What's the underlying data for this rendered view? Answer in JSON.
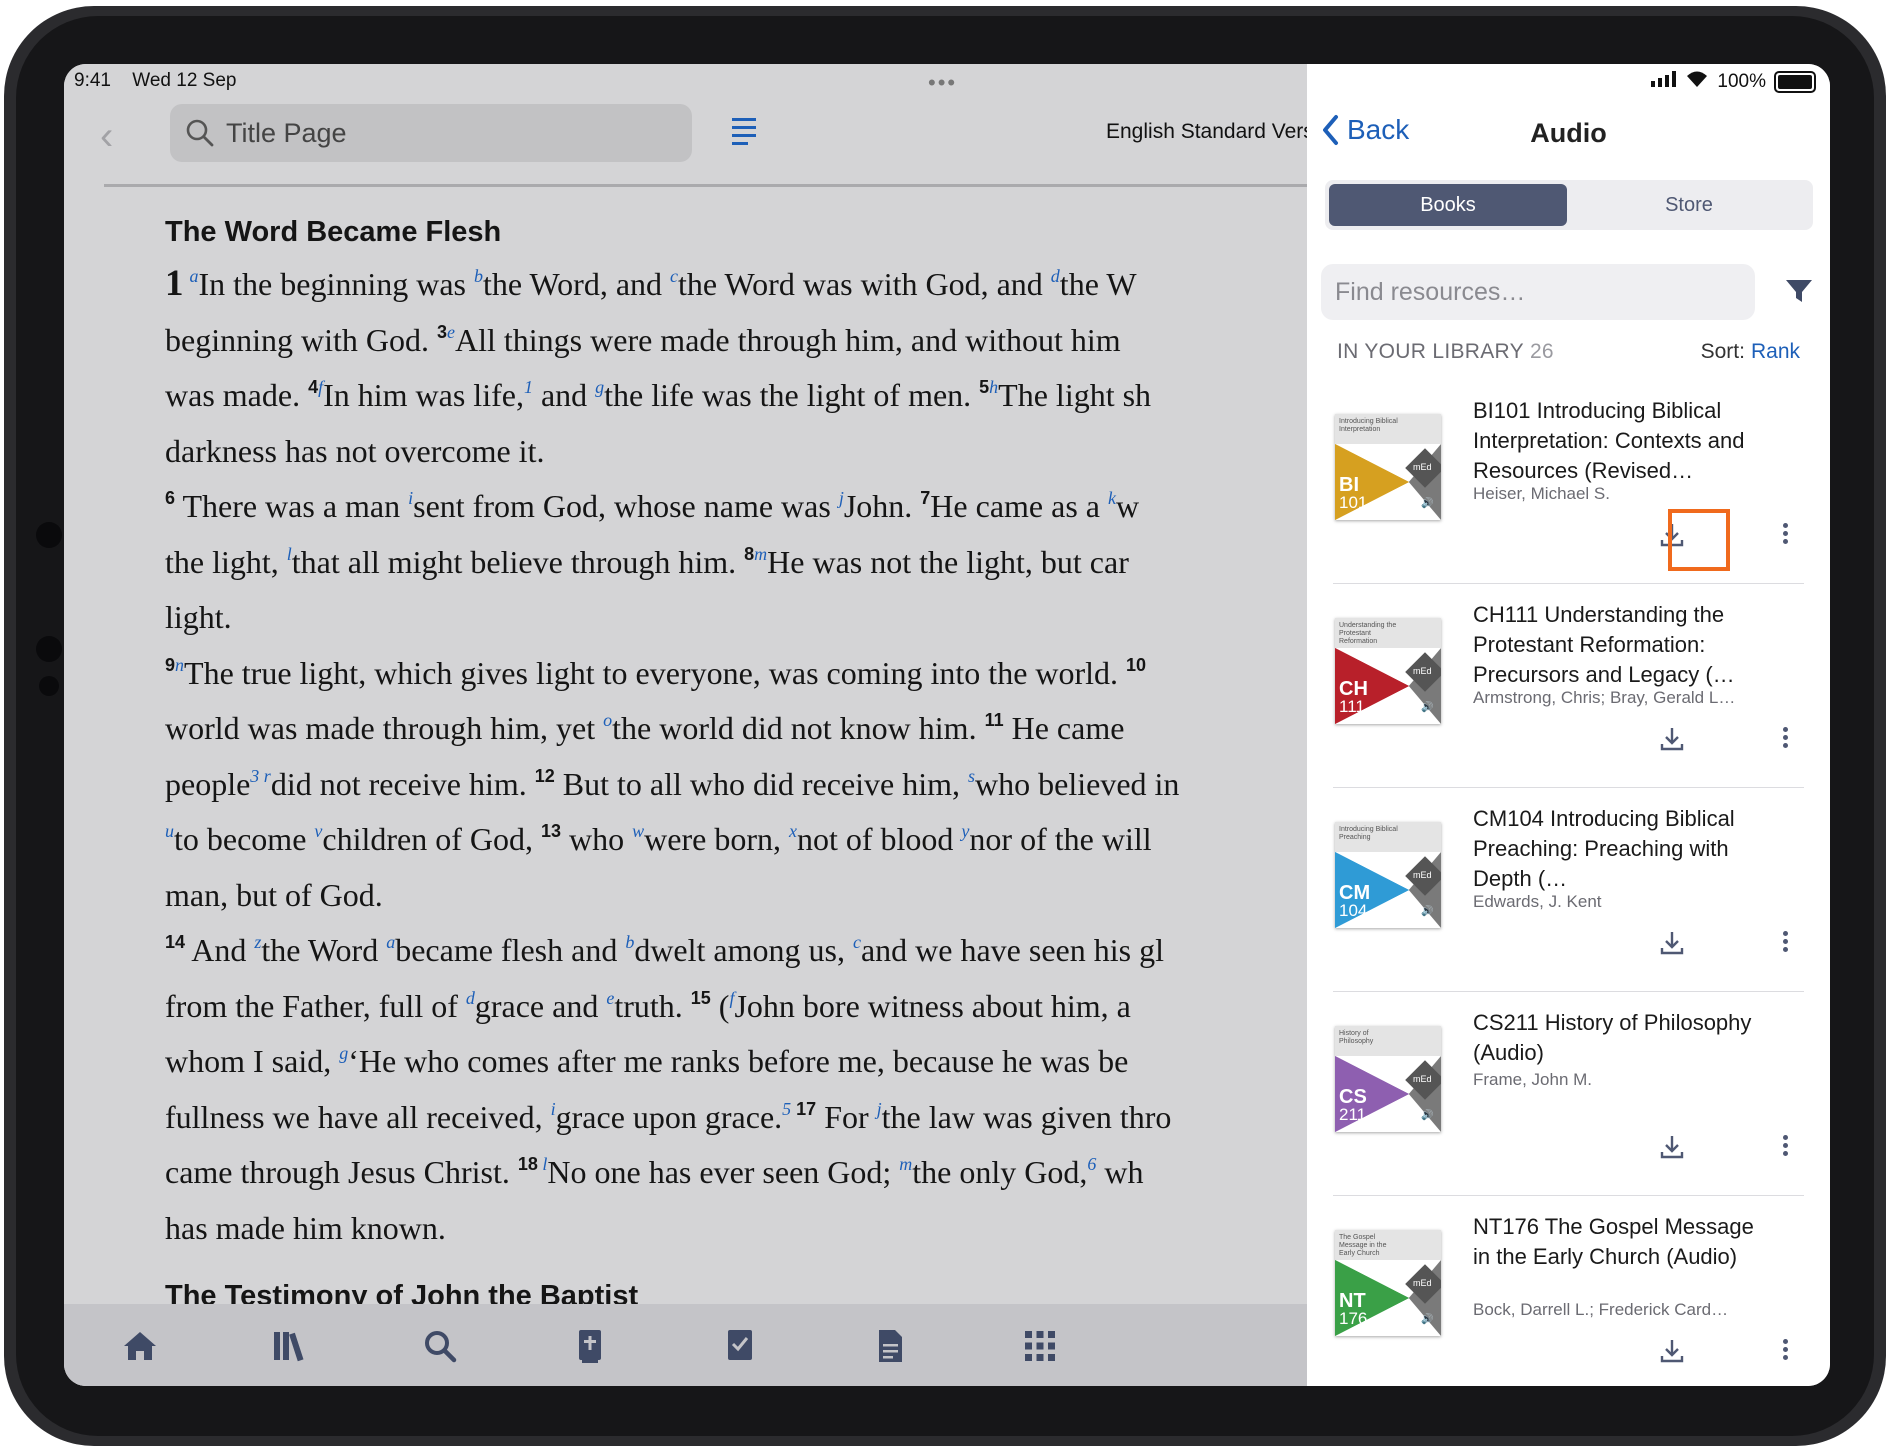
{
  "status": {
    "time": "9:41",
    "date": "Wed 12 Sep",
    "battery": "100%"
  },
  "reader": {
    "search_label": "Title Page",
    "version_label": "English Standard Vers",
    "heading": "The Word Became Flesh",
    "next_heading": "The Testimony of John the Baptist",
    "lines": [
      "In the beginning was the Word, and the Word was with God, and the W",
      "beginning with God. All things were made through him, and without him",
      "was made. In him was life, and the life was the light of men. The light sh",
      "darkness has not overcome it.",
      "There was a man sent from God, whose name was John. He came as a w",
      "the light, that all might believe through him. He was not the light, but car",
      "light.",
      "The true light, which gives light to everyone, was coming into the world.",
      "world was made through him, yet the world did not know him. He came",
      "people did not receive him. But to all who did receive him, who believed in",
      "to become children of God, who were born, not of blood nor of the will",
      "man, but of God.",
      "And the Word became flesh and dwelt among us, and we have seen his gl",
      "from the Father, full of grace and truth. (John bore witness about him, a",
      "whom I said, ‘He who comes after me ranks before me, because he was be",
      "fullness we have all received, grace upon grace. For the law was given thro",
      "came through Jesus Christ. No one has ever seen God; the only God, wh",
      "has made him known."
    ],
    "seg": {
      "l1a": "In the beginning was ",
      "l1b": "the Word, and ",
      "l1c": "the Word was with God, and ",
      "l1d": "the W",
      "l2a": "beginning with God. ",
      "l2b": "All things were made through him, and without him",
      "l3a": "was made. ",
      "l3b": "In him was life,",
      "l3c": " and ",
      "l3d": "the life was the light of men. ",
      "l3e": "The light sh",
      "l5a": " There was a man ",
      "l5b": "sent from God, whose name was ",
      "l5c": "John. ",
      "l5d": "He came as a ",
      "l5e": "w",
      "l6a": "the light, ",
      "l6b": "that all might believe through him. ",
      "l6c": "He was not the light, but car",
      "l8a": "The true light, which gives light to everyone, was coming into the world. ",
      "l9a": "world was made through him, yet ",
      "l9b": "the world did not know him. ",
      "l9c": " He came",
      "l10a": "people",
      "l10b": "did not receive him. ",
      "l10c": " But to all who did receive him, ",
      "l10d": "who believed in",
      "l11a": "to become ",
      "l11b": "children of God, ",
      "l11c": " who ",
      "l11d": "were born, ",
      "l11e": "not of blood ",
      "l11f": "nor of the will",
      "l13a": " And ",
      "l13b": "the Word ",
      "l13c": "became flesh and ",
      "l13d": "dwelt among us, ",
      "l13e": "and we have seen his gl",
      "l14a": "from the Father, full of ",
      "l14b": "grace and ",
      "l14c": "truth. ",
      "l14d": " (",
      "l14e": "John bore witness about him, a",
      "l15a": "whom I said, ",
      "l15b": "‘He who comes after me ranks before me, because he was be",
      "l16a": "fullness we have all received, ",
      "l16b": "grace upon grace.",
      "l16c": " For ",
      "l16d": "the law was given thro",
      "l17a": "came through Jesus Christ. ",
      "l17b": "No one has ever seen God; ",
      "l17c": "the only God,",
      "l17d": " wh"
    },
    "tabs": [
      "home",
      "library",
      "search",
      "bible",
      "plans",
      "notes",
      "more"
    ]
  },
  "panel": {
    "back_label": "Back",
    "title": "Audio",
    "segment_books": "Books",
    "segment_store": "Store",
    "search_placeholder": "Find resources…",
    "library_label": "IN YOUR LIBRARY",
    "library_count": "26",
    "sort_label": "Sort:",
    "sort_value": "Rank",
    "items": [
      {
        "title": "BI101 Introducing Biblical Interpretation: Contexts and Resources (Revised…",
        "author": "Heiser, Michael S.",
        "code": "BI",
        "num": "101",
        "band": "Introducing Biblical Interpretation",
        "color": "#d6a020"
      },
      {
        "title": "CH111 Understanding the Protestant Reformation: Precursors and Legacy (…",
        "author": "Armstrong, Chris; Bray, Gerald L…",
        "code": "CH",
        "num": "111",
        "band": "Understanding the Protestant Reformation",
        "color": "#b8202a"
      },
      {
        "title": "CM104 Introducing Biblical Preaching: Preaching with Depth (…",
        "author": "Edwards, J. Kent",
        "code": "CM",
        "num": "104",
        "band": "Introducing Biblical Preaching",
        "color": "#2f9bd6"
      },
      {
        "title": "CS211 History of Philosophy (Audio)",
        "author": "Frame, John M.",
        "code": "CS",
        "num": "211",
        "band": "History of Philosophy",
        "color": "#8e5fb0"
      },
      {
        "title": "NT176 The Gospel Message in the Early Church (Audio)",
        "author": "Bock, Darrell L.; Frederick Card…",
        "code": "NT",
        "num": "176",
        "band": "The Gospel Message in the Early Church",
        "color": "#3aa047"
      }
    ]
  },
  "colors": {
    "accent": "#1d5fb8",
    "highlight": "#f06a1d",
    "segment_active": "#4f5873"
  }
}
